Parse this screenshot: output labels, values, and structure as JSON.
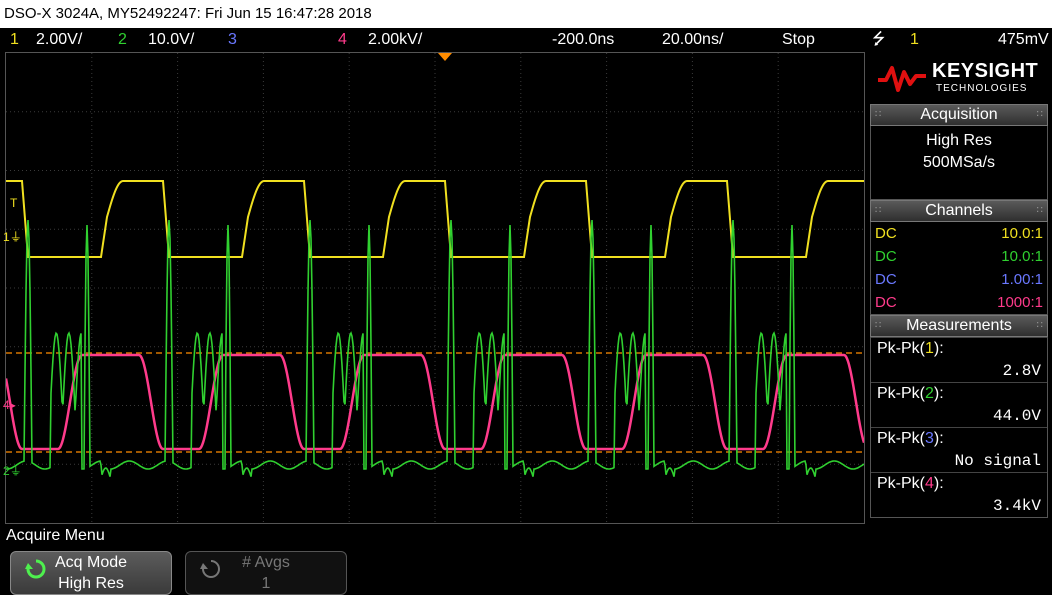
{
  "title_bar": "DSO-X 3024A, MY52492247: Fri Jun 15 16:47:28 2018",
  "status": {
    "ch1_num": "1",
    "ch1_scale": "2.00V/",
    "ch2_num": "2",
    "ch2_scale": "10.0V/",
    "ch3_num": "3",
    "ch4_num": "4",
    "ch4_scale": "2.00kV/",
    "time_offset": "-200.0ns",
    "time_scale": "20.00ns/",
    "run_state": "Stop",
    "trigger_icon": "trigger-edge-icon",
    "trigger_ch": "1",
    "trigger_level": "475mV"
  },
  "brand": {
    "name": "KEYSIGHT",
    "sub": "TECHNOLOGIES"
  },
  "acquisition": {
    "header": "Acquisition",
    "mode": "High Res",
    "rate": "500MSa/s"
  },
  "channels": {
    "header": "Channels",
    "rows": [
      {
        "coupling": "DC",
        "probe": "10.0:1",
        "color": "#f0e020"
      },
      {
        "coupling": "DC",
        "probe": "10.0:1",
        "color": "#30d030"
      },
      {
        "coupling": "DC",
        "probe": "1.00:1",
        "color": "#6a78ff"
      },
      {
        "coupling": "DC",
        "probe": "1000:1",
        "color": "#ff3b8b"
      }
    ]
  },
  "measurements": {
    "header": "Measurements",
    "items": [
      {
        "label": "Pk-Pk(",
        "ch": "1",
        "value": "2.8V"
      },
      {
        "label": "Pk-Pk(",
        "ch": "2",
        "value": "44.0V"
      },
      {
        "label": "Pk-Pk(",
        "ch": "3",
        "value": "No signal"
      },
      {
        "label": "Pk-Pk(",
        "ch": "4",
        "value": "3.4kV"
      }
    ]
  },
  "menu": {
    "title": "Acquire Menu",
    "softkeys": [
      {
        "label": "Acq Mode",
        "value": "High Res"
      },
      {
        "label": "# Avgs",
        "value": "1"
      }
    ]
  },
  "markers": {
    "trigger_T": "T",
    "ch1": "1",
    "ch4": "4",
    "ch2": "2"
  },
  "colors": {
    "ch1": "#f0e020",
    "ch2": "#30d030",
    "ch3": "#6a78ff",
    "ch4": "#ff3b8b",
    "cursor": "#ff8c00"
  }
}
